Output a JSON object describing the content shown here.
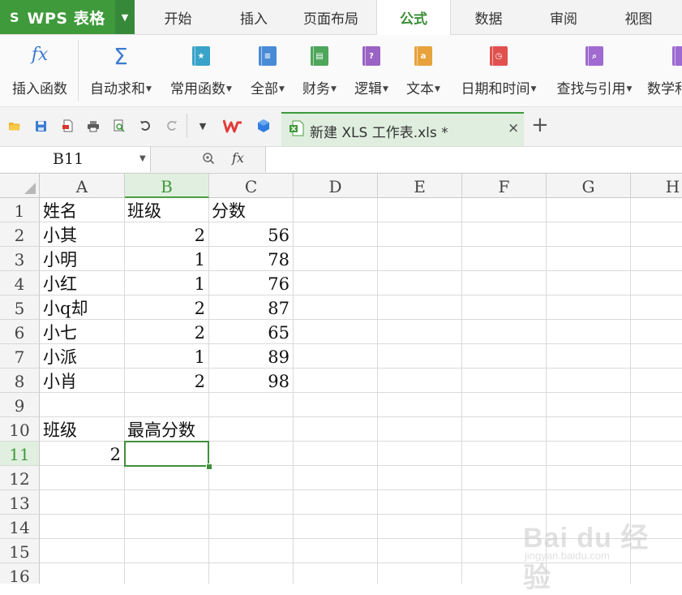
{
  "app": {
    "logo": "S",
    "title": "WPS 表格"
  },
  "menu_tabs": [
    "开始",
    "插入",
    "页面布局",
    "公式",
    "数据",
    "审阅",
    "视图"
  ],
  "active_menu_tab": "公式",
  "ribbon": {
    "items": [
      {
        "label": "插入函数",
        "icon": "fx-icon"
      },
      {
        "label": "自动求和",
        "icon": "sigma-icon",
        "dropdown": true
      },
      {
        "label": "常用函数",
        "icon": "common-functions-icon",
        "dropdown": true
      },
      {
        "label": "全部",
        "icon": "all-functions-icon",
        "dropdown": true
      },
      {
        "label": "财务",
        "icon": "finance-icon",
        "dropdown": true
      },
      {
        "label": "逻辑",
        "icon": "logic-icon",
        "dropdown": true
      },
      {
        "label": "文本",
        "icon": "text-icon",
        "dropdown": true
      },
      {
        "label": "日期和时间",
        "icon": "datetime-icon",
        "dropdown": true
      },
      {
        "label": "查找与引用",
        "icon": "lookup-icon",
        "dropdown": true
      },
      {
        "label": "数学和",
        "icon": "math-icon"
      }
    ],
    "icon_glyphs": {
      "fx": "fx",
      "sigma": "Σ",
      "logic": "?",
      "text": "a"
    }
  },
  "document_tab": {
    "name": "新建 XLS 工作表.xls *",
    "close": "×",
    "new_tab": "+"
  },
  "formula_bar": {
    "cell_ref": "B11",
    "fx_label": "fx",
    "formula": ""
  },
  "sheet": {
    "columns": [
      "A",
      "B",
      "C",
      "D",
      "E",
      "F",
      "G",
      "H"
    ],
    "selected_column": "B",
    "rows": [
      "1",
      "2",
      "3",
      "4",
      "5",
      "6",
      "7",
      "8",
      "9",
      "10",
      "11",
      "12",
      "13",
      "14",
      "15",
      "16"
    ],
    "selected_row": "11",
    "cells": {
      "A1": "姓名",
      "B1": "班级",
      "C1": "分数",
      "A2": "小其",
      "B2": "2",
      "C2": "56",
      "A3": "小明",
      "B3": "1",
      "C3": "78",
      "A4": "小红",
      "B4": "1",
      "C4": "76",
      "A5": "小q却",
      "B5": "2",
      "C5": "87",
      "A6": "小七",
      "B6": "2",
      "C6": "65",
      "A7": "小派",
      "B7": "1",
      "C7": "89",
      "A8": "小肖",
      "B8": "2",
      "C8": "98",
      "A10": "班级",
      "B10": "最高分数",
      "A11": "2"
    },
    "active_cell": "B11"
  },
  "watermark": {
    "brand": "Bai du 经验",
    "sub": "jingyan.baidu.com"
  },
  "colors": {
    "accent_green": "#3f9a3b",
    "header_gray": "#f4f4f4",
    "selected_header": "#e1efe0"
  }
}
